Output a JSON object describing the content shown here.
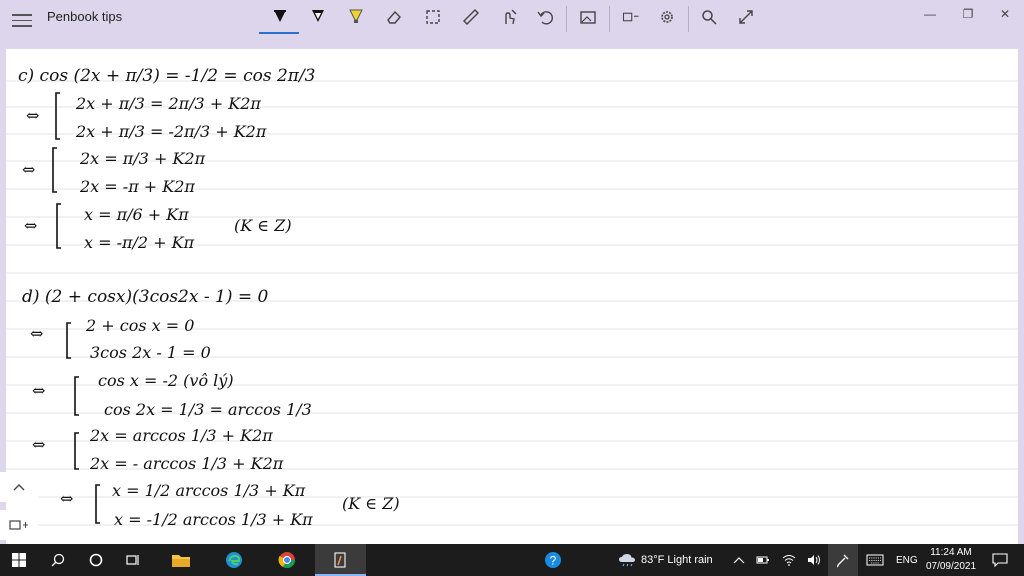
{
  "app": {
    "title": "Penbook tips"
  },
  "toolbar": {
    "tools": [
      "pen-black-icon",
      "pen-outline-icon",
      "highlighter-icon",
      "eraser-icon",
      "lasso-select-icon",
      "ruler-icon",
      "touch-writing-icon",
      "undo-icon"
    ],
    "right_tools": [
      "insert-image-icon",
      "shapes-icon",
      "settings-icon",
      "search-icon",
      "expand-icon"
    ],
    "accent_color": "#2b6fd6"
  },
  "window_controls": {
    "minimize": "—",
    "restore": "❐",
    "close": "✕"
  },
  "notes": {
    "part_c": {
      "heading": "c) cos (2x + π/3) = -1/2 = cos 2π/3",
      "step1_line1": "2x + π/3 = 2π/3 + K2π",
      "step1_line2": "2x + π/3 = -2π/3 + K2π",
      "step2_line1": "2x = π/3 + K2π",
      "step2_line2": "2x = -π + K2π",
      "step3_line1": "x = π/6 + Kπ",
      "step3_line2": "x = -π/2 + Kπ",
      "condition": "(K ∈ Z)"
    },
    "part_d": {
      "heading": "d) (2 + cosx)(3cos2x - 1) = 0",
      "step1_line1": "2 + cos x = 0",
      "step1_line2": "3cos 2x - 1 = 0",
      "step2_line1": "cos x = -2 (vô lý)",
      "step2_line2": "cos 2x = 1/3 = arccos 1/3",
      "step3_line1": "2x = arccos 1/3 + K2π",
      "step3_line2": "2x = - arccos 1/3 + K2π",
      "step4_line1": "x = 1/2 arccos 1/3 + Kπ",
      "step4_line2": "x = -1/2 arccos 1/3 + Kπ",
      "condition": "(K ∈ Z)"
    },
    "equiv_symbol": "⇔"
  },
  "side_controls": {
    "scroll_up": "^",
    "page_icon": "page-layout-icon"
  },
  "taskbar": {
    "weather": "83°F  Light rain",
    "language": "ENG",
    "time": "11:24 AM",
    "date": "07/09/2021"
  }
}
